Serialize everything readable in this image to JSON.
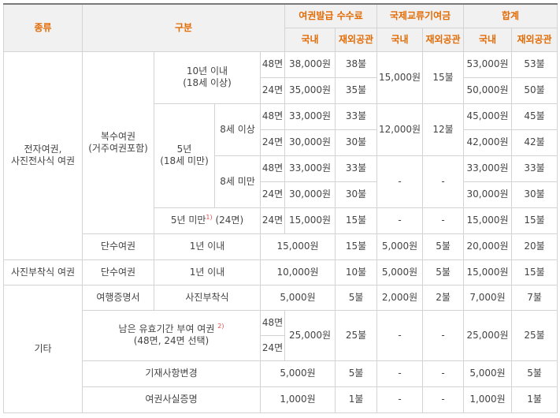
{
  "header": {
    "type": "종류",
    "division": "구분",
    "fee": "여권발급 수수료",
    "intl": "국제교류기여금",
    "total": "합계",
    "domestic": "국내",
    "overseas": "재외공관"
  },
  "types": {
    "electronic": "전자여권,\n사진전사식 여권",
    "photo_attached": "사진부착식 여권",
    "other": "기타"
  },
  "cats": {
    "multiple": "복수여권\n(거주여권포함)",
    "ten_year": "10년 이내\n(18세 이상)",
    "five_year": "5년\n(18세 미만)",
    "age8_over": "8세 이상",
    "age8_under": "8세 미만",
    "five_under": "5년 미만",
    "five_under_sup": "1)",
    "five_under_pages": "(24면)",
    "single": "단수여권",
    "within1": "1년 이내",
    "travel_cert": "여행증명서",
    "photo_attach": "사진부착식",
    "remaining": "남은 유효기간 부여 여권",
    "remaining_sup": "2)",
    "remaining_sub": "(48면, 24면 선택)",
    "change": "기재사항변경",
    "fact_cert": "여권사실증명"
  },
  "rows": {
    "r1": {
      "pages": "48면",
      "fee_dom": "38,000원",
      "fee_ov": "38불",
      "intl_dom": "15,000원",
      "intl_ov": "15불",
      "tot_dom": "53,000원",
      "tot_ov": "53불"
    },
    "r2": {
      "pages": "24면",
      "fee_dom": "35,000원",
      "fee_ov": "35불",
      "tot_dom": "50,000원",
      "tot_ov": "50불"
    },
    "r3": {
      "pages": "48면",
      "fee_dom": "33,000원",
      "fee_ov": "33불",
      "intl_dom": "12,000원",
      "intl_ov": "12불",
      "tot_dom": "45,000원",
      "tot_ov": "45불"
    },
    "r4": {
      "pages": "24면",
      "fee_dom": "30,000원",
      "fee_ov": "30불",
      "tot_dom": "42,000원",
      "tot_ov": "42불"
    },
    "r5": {
      "pages": "48면",
      "fee_dom": "33,000원",
      "fee_ov": "33불",
      "intl_dom": "-",
      "intl_ov": "-",
      "tot_dom": "33,000원",
      "tot_ov": "33불"
    },
    "r6": {
      "pages": "24면",
      "fee_dom": "30,000원",
      "fee_ov": "30불",
      "tot_dom": "30,000원",
      "tot_ov": "30불"
    },
    "r7": {
      "pages": "24면",
      "fee_dom": "15,000원",
      "fee_ov": "15불",
      "intl_dom": "-",
      "intl_ov": "-",
      "tot_dom": "15,000원",
      "tot_ov": "15불"
    },
    "r8": {
      "fee_dom": "15,000원",
      "fee_ov": "15불",
      "intl_dom": "5,000원",
      "intl_ov": "5불",
      "tot_dom": "20,000원",
      "tot_ov": "20불"
    },
    "r9": {
      "fee_dom": "10,000원",
      "fee_ov": "10불",
      "intl_dom": "5,000원",
      "intl_ov": "5불",
      "tot_dom": "15,000원",
      "tot_ov": "15불"
    },
    "r10": {
      "fee_dom": "5,000원",
      "fee_ov": "5불",
      "intl_dom": "2,000원",
      "intl_ov": "2불",
      "tot_dom": "7,000원",
      "tot_ov": "7불"
    },
    "r11": {
      "pages_a": "48면",
      "pages_b": "24면",
      "fee_dom": "25,000원",
      "fee_ov": "25불",
      "intl_dom": "-",
      "intl_ov": "-",
      "tot_dom": "25,000원",
      "tot_ov": "25불"
    },
    "r12": {
      "fee_dom": "5,000원",
      "fee_ov": "5불",
      "intl_dom": "-",
      "intl_ov": "-",
      "tot_dom": "5,000원",
      "tot_ov": "5불"
    },
    "r13": {
      "fee_dom": "1,000원",
      "fee_ov": "1불",
      "intl_dom": "-",
      "intl_ov": "-",
      "tot_dom": "1,000원",
      "tot_ov": "1불"
    }
  }
}
